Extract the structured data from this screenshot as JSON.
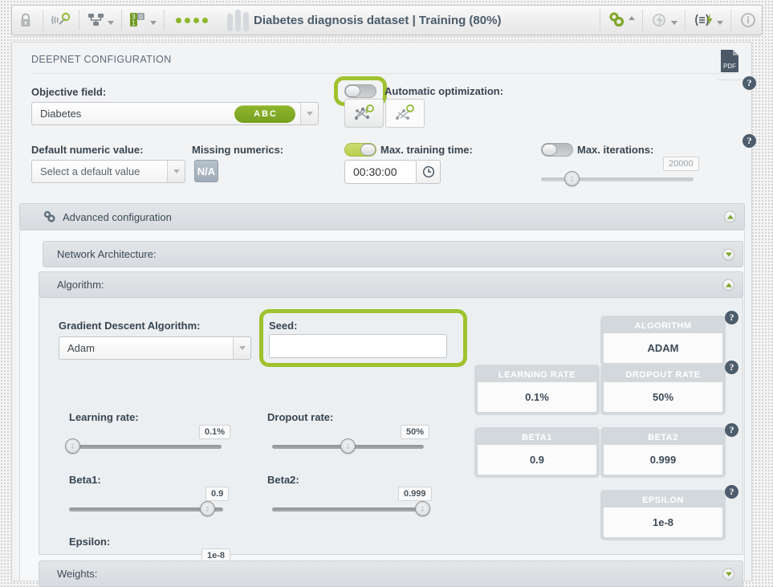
{
  "toolbar": {
    "lock_icon": "lock-icon",
    "resource_icon": "signal-search-icon",
    "cluster_icon": "network-topology-icon",
    "fields_icon": "field-types-icon",
    "dots_icon": "status-dots-icon",
    "bars_icon": "deepnet-bars-icon",
    "title": "Diabetes diagnosis dataset | Training (80%)",
    "gears_icon": "gears-icon",
    "flash_icon": "lightning-cloud-icon",
    "script_icon": "script-flash-icon",
    "info_icon": "info-icon"
  },
  "panel": {
    "title": "DEEPNET CONFIGURATION",
    "pdf_icon": "pdf-download-icon",
    "help_icon": "help-icon"
  },
  "objective": {
    "label": "Objective field:",
    "value": "Diabetes",
    "badge": "ABC",
    "dropdown_icon": "chevron-down-icon"
  },
  "automatic_optimization": {
    "label": "Automatic optimization:",
    "toggle_state": "off",
    "highlighted": true,
    "option_1_icon": "network-search-left-icon",
    "option_2_icon": "network-search-right-icon"
  },
  "default_numeric": {
    "label": "Default numeric value:",
    "placeholder": "Select a default value",
    "dropdown_icon": "chevron-down-icon"
  },
  "missing_numerics": {
    "label": "Missing numerics:",
    "button_label": "N/A"
  },
  "max_training_time": {
    "label": "Max. training time:",
    "toggle_state": "on",
    "value": "00:30:00",
    "clock_icon": "clock-icon"
  },
  "max_iterations": {
    "label": "Max. iterations:",
    "toggle_state": "off",
    "value": "20000",
    "slider_percent": 11
  },
  "advanced_configuration": {
    "label": "Advanced configuration",
    "gear_icon": "gears-icon",
    "collapse_icon": "collapse-up-icon"
  },
  "network_architecture": {
    "label": "Network Architecture:",
    "collapse_icon": "expand-down-icon"
  },
  "algorithm_section": {
    "label": "Algorithm:",
    "collapse_icon": "collapse-up-icon"
  },
  "gradient_descent": {
    "label": "Gradient Descent Algorithm:",
    "value": "Adam",
    "dropdown_icon": "chevron-down-icon"
  },
  "seed": {
    "label": "Seed:",
    "value": "",
    "highlighted": true
  },
  "sliders": [
    {
      "name": "learning-rate",
      "label": "Learning rate:",
      "value": "0.1%",
      "percent": 2
    },
    {
      "name": "dropout-rate",
      "label": "Dropout rate:",
      "value": "50%",
      "percent": 50
    },
    {
      "name": "beta1",
      "label": "Beta1:",
      "value": "0.9",
      "percent": 90
    },
    {
      "name": "beta2",
      "label": "Beta2:",
      "value": "0.999",
      "percent": 99
    },
    {
      "name": "epsilon",
      "label": "Epsilon:",
      "value": "1e-8",
      "percent": 2
    }
  ],
  "cards": [
    {
      "name": "algorithm",
      "title": "ALGORITHM",
      "value": "ADAM"
    },
    {
      "name": "learning-rate",
      "title": "LEARNING RATE",
      "value": "0.1%"
    },
    {
      "name": "dropout-rate",
      "title": "DROPOUT RATE",
      "value": "50%"
    },
    {
      "name": "beta1",
      "title": "BETA1",
      "value": "0.9"
    },
    {
      "name": "beta2",
      "title": "BETA2",
      "value": "0.999"
    },
    {
      "name": "epsilon",
      "title": "EPSILON",
      "value": "1e-8"
    }
  ],
  "weights_section": {
    "label": "Weights:",
    "collapse_icon": "expand-down-icon"
  },
  "colors": {
    "accent_green": "#8cb82b",
    "highlight_green": "#9fc22e",
    "badge_green": "#7da326",
    "text_dark": "#38444f",
    "panel_bg": "#f2f3f4"
  }
}
